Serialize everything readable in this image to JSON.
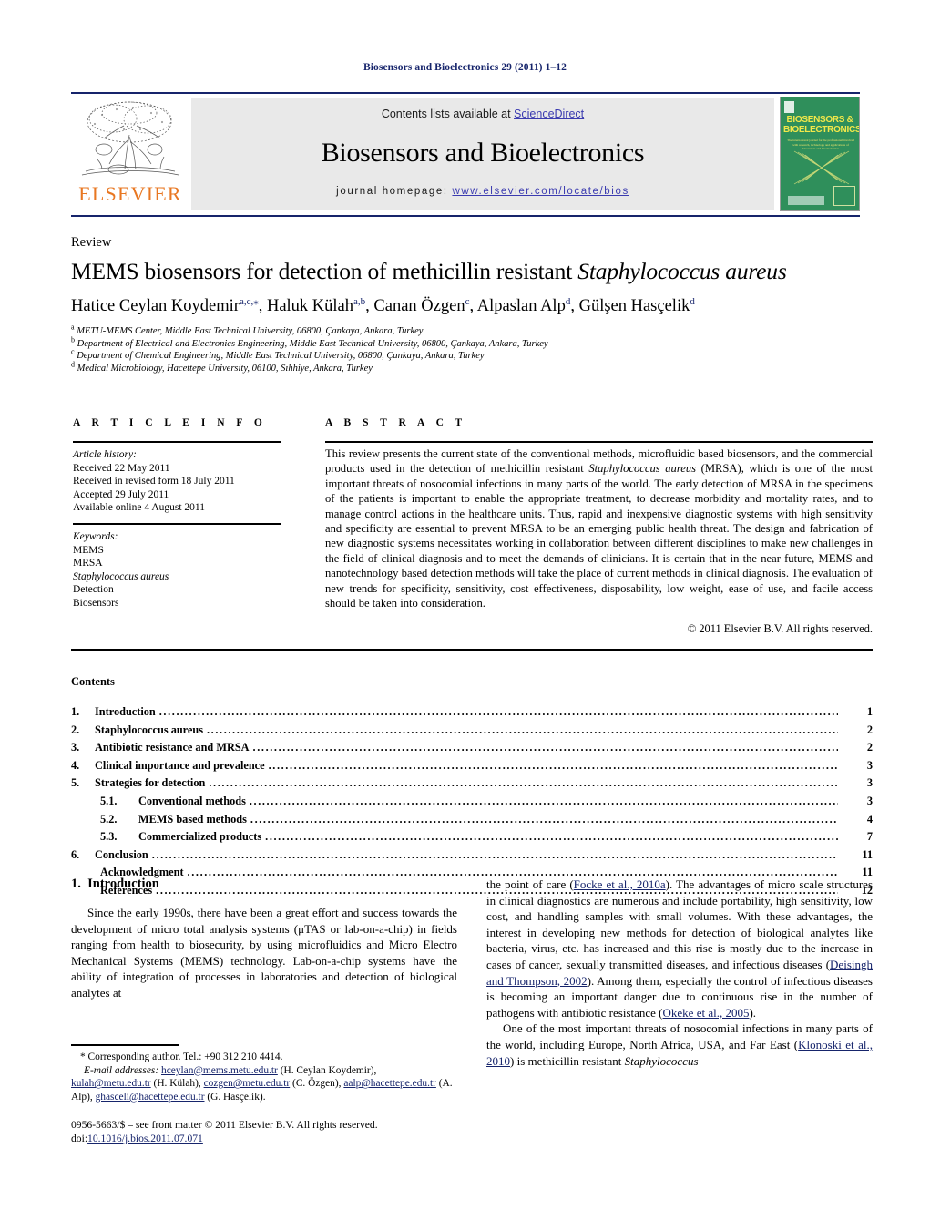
{
  "running_head": "Biosensors and Bioelectronics 29 (2011) 1–12",
  "masthead": {
    "contents_line_prefix": "Contents lists available at ",
    "sciencedirect": "ScienceDirect",
    "journal_name": "Biosensors and Bioelectronics",
    "homepage_prefix": "journal homepage: ",
    "homepage_url": "www.elsevier.com/locate/bios",
    "publisher": "ELSEVIER",
    "cover": {
      "title": "BIOSENSORS & BIOELECTRONICS",
      "subtitle": "The international journal for the professional involved with research, technology and applications of biosensors and bioelectronics"
    },
    "link_color": "#3b3bb0",
    "rule_color": "#16246b",
    "panel_bg": "#e9e9e9",
    "elsevier_orange": "#e87722",
    "cover_green": "#2f8f5b"
  },
  "article": {
    "type_label": "Review",
    "title_main": "MEMS biosensors for detection of methicillin resistant ",
    "title_italic": "Staphylococcus aureus",
    "authors": [
      {
        "name": "Hatice Ceylan Koydemir",
        "sup": "a,c,⁎",
        "sep": ", "
      },
      {
        "name": "Haluk Külah",
        "sup": "a,b",
        "sep": ", "
      },
      {
        "name": "Canan Özgen",
        "sup": "c",
        "sep": ", "
      },
      {
        "name": "Alpaslan Alp",
        "sup": "d",
        "sep": ", "
      },
      {
        "name": "Gülşen Hasçelik",
        "sup": "d",
        "sep": ""
      }
    ],
    "affiliations": [
      {
        "mark": "a",
        "text": "METU-MEMS Center, Middle East Technical University, 06800, Çankaya, Ankara, Turkey"
      },
      {
        "mark": "b",
        "text": "Department of Electrical and Electronics Engineering, Middle East Technical University, 06800, Çankaya, Ankara, Turkey"
      },
      {
        "mark": "c",
        "text": "Department of Chemical Engineering, Middle East Technical University, 06800, Çankaya, Ankara, Turkey"
      },
      {
        "mark": "d",
        "text": "Medical Microbiology, Hacettepe University, 06100, Sıhhiye, Ankara, Turkey"
      }
    ]
  },
  "info": {
    "heading": "A R T I C L E    I N F O",
    "history_label": "Article history:",
    "history": [
      "Received 22 May 2011",
      "Received in revised form 18 July 2011",
      "Accepted 29 July 2011",
      "Available online 4 August 2011"
    ],
    "keywords_label": "Keywords:",
    "keywords": [
      "MEMS",
      "MRSA",
      "Staphylococcus aureus",
      "Detection",
      "Biosensors"
    ],
    "keyword_italic_index": 2
  },
  "abstract": {
    "heading": "A B S T R A C T",
    "part1": "This review presents the current state of the conventional methods, microfluidic based biosensors, and the commercial products used in the detection of methicillin resistant ",
    "species": "Staphylococcus aureus",
    "part2": " (MRSA), which is one of the most important threats of nosocomial infections in many parts of the world. The early detection of MRSA in the specimens of the patients is important to enable the appropriate treatment, to decrease morbidity and mortality rates, and to manage control actions in the healthcare units. Thus, rapid and inexpensive diagnostic systems with high sensitivity and specificity are essential to prevent MRSA to be an emerging public health threat. The design and fabrication of new diagnostic systems necessitates working in collaboration between different disciplines to make new challenges in the field of clinical diagnosis and to meet the demands of clinicians. It is certain that in the near future, MEMS and nanotechnology based detection methods will take the place of current methods in clinical diagnosis. The evaluation of new trends for specificity, sensitivity, cost effectiveness, disposability, low weight, ease of use, and facile access should be taken into consideration.",
    "copyright": "© 2011 Elsevier B.V. All rights reserved."
  },
  "contents": {
    "heading": "Contents",
    "entries": [
      {
        "num": "1.",
        "label": "Introduction",
        "page": "1",
        "level": 1
      },
      {
        "num": "2.",
        "label": "Staphylococcus aureus",
        "page": "2",
        "level": 1
      },
      {
        "num": "3.",
        "label": "Antibiotic resistance and MRSA",
        "page": "2",
        "level": 1
      },
      {
        "num": "4.",
        "label": "Clinical importance and prevalence",
        "page": "3",
        "level": 1
      },
      {
        "num": "5.",
        "label": "Strategies for detection",
        "page": "3",
        "level": 1
      },
      {
        "num": "5.1.",
        "label": "Conventional methods",
        "page": "3",
        "level": 2
      },
      {
        "num": "5.2.",
        "label": "MEMS based methods",
        "page": "4",
        "level": 2
      },
      {
        "num": "5.3.",
        "label": "Commercialized products",
        "page": "7",
        "level": 2
      },
      {
        "num": "6.",
        "label": "Conclusion",
        "page": "11",
        "level": 1
      },
      {
        "num": "",
        "label": "Acknowledgment",
        "page": "11",
        "level": 3
      },
      {
        "num": "",
        "label": "References",
        "page": "12",
        "level": 3
      }
    ]
  },
  "body": {
    "section_number": "1.",
    "section_title": "Introduction",
    "left_paragraph": "Since the early 1990s, there have been a great effort and success towards the development of micro total analysis systems (μTAS or lab-on-a-chip) in fields ranging from health to biosecurity, by using microfluidics and Micro Electro Mechanical Systems (MEMS) technology. Lab-on-a-chip systems have the ability of integration of processes in laboratories and detection of biological analytes at",
    "right_p1_a": "the point of care (",
    "right_p1_cite1": "Focke et al., 2010a",
    "right_p1_b": "). The advantages of micro scale structures in clinical diagnostics are numerous and include portability, high sensitivity, low cost, and handling samples with small volumes. With these advantages, the interest in developing new methods for detection of biological analytes like bacteria, virus, etc. has increased and this rise is mostly due to the increase in cases of cancer, sexually transmitted diseases, and infectious diseases (",
    "right_p1_cite2": "Deisingh and Thompson, 2002",
    "right_p1_c": "). Among them, especially the control of infectious diseases is becoming an important danger due to continuous rise in the number of pathogens with antibiotic resistance (",
    "right_p1_cite3": "Okeke et al., 2005",
    "right_p1_d": ").",
    "right_p2_a": "One of the most important threats of nosocomial infections in many parts of the world, including Europe, North Africa, USA, and Far East (",
    "right_p2_cite1": "Klonoski et al., 2010",
    "right_p2_b": ") is methicillin resistant ",
    "right_p2_species": "Staphylococcus"
  },
  "footer": {
    "corresponding": "* Corresponding author. Tel.: +90 312 210 4414.",
    "email_label": "E-mail addresses:",
    "emails": [
      {
        "addr": "hceylan@mems.metu.edu.tr",
        "who": " (H. Ceylan Koydemir),"
      },
      {
        "addr": "kulah@metu.edu.tr",
        "who": " (H. Külah),"
      },
      {
        "addr": "cozgen@metu.edu.tr",
        "who": " (C. Özgen),"
      },
      {
        "addr": "aalp@hacettepe.edu.tr",
        "who": " (A. Alp),"
      },
      {
        "addr": "ghasceli@hacettepe.edu.tr",
        "who": " (G. Hasçelik)."
      }
    ],
    "issn_line": "0956-5663/$ – see front matter © 2011 Elsevier B.V. All rights reserved.",
    "doi_prefix": "doi:",
    "doi": "10.1016/j.bios.2011.07.071",
    "link_color": "#16246b"
  }
}
